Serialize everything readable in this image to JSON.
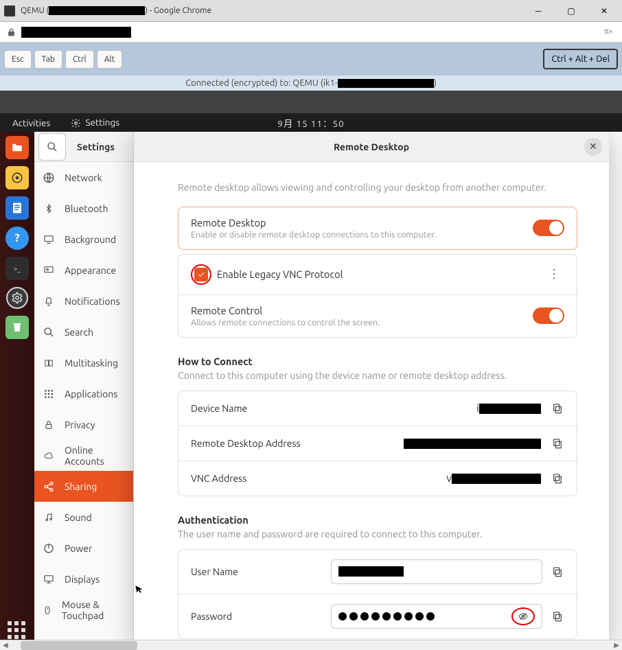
{
  "chrome": {
    "title_prefix": "QEMU (",
    "title_suffix": ") - Google Chrome"
  },
  "novnc": {
    "esc": "Esc",
    "tab": "Tab",
    "ctrl": "Ctrl",
    "alt": "Alt",
    "cad": "Ctrl + Alt + Del",
    "status_prefix": "Connected (encrypted) to: QEMU (ik1-",
    "status_suffix": ")"
  },
  "topbar": {
    "activities": "Activities",
    "settings": "Settings",
    "clock": "9月 15  11：50"
  },
  "sidebar": {
    "app_title": "Settings",
    "items": [
      "Network",
      "Bluetooth",
      "Background",
      "Appearance",
      "Notifications",
      "Search",
      "Multitasking",
      "Applications",
      "Privacy",
      "Online Accounts",
      "Sharing",
      "Sound",
      "Power",
      "Displays",
      "Mouse & Touchpad"
    ]
  },
  "dialog": {
    "title": "Remote Desktop",
    "desc": "Remote desktop allows viewing and controlling your desktop from another computer.",
    "rd_title": "Remote Desktop",
    "rd_sub": "Enable or disable remote desktop connections to this computer.",
    "legacy_vnc": "Enable Legacy VNC Protocol",
    "rc_title": "Remote Control",
    "rc_sub": "Allows remote connections to control the screen.",
    "howto_head": "How to Connect",
    "howto_sub": "Connect to this computer using the device name or remote desktop address.",
    "device_name": "Device Name",
    "device_name_prefix": "i",
    "rdp_addr": "Remote Desktop Address",
    "vnc_addr": "VNC Address",
    "vnc_addr_prefix": "v",
    "auth_head": "Authentication",
    "auth_sub": "The user name and password are required to connect to this computer.",
    "user_name": "User Name",
    "password": "Password"
  }
}
